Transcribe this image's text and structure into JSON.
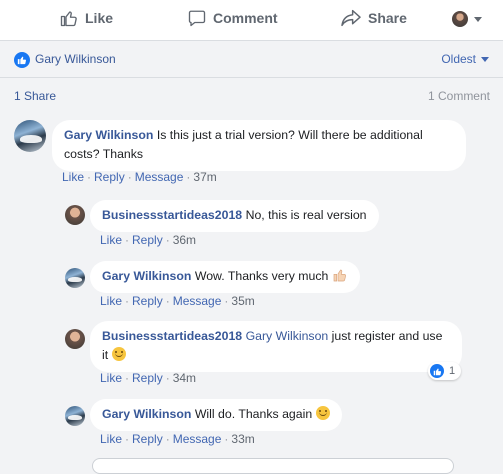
{
  "actions": {
    "like": "Like",
    "comment": "Comment",
    "share": "Share"
  },
  "reactions": {
    "reactor": "Gary Wilkinson",
    "sort": "Oldest"
  },
  "counts": {
    "shares": "1 Share",
    "comments": "1 Comment"
  },
  "comment": {
    "author": "Gary Wilkinson",
    "text": "Is this just a trial version? Will there be additional costs? Thanks",
    "like": "Like",
    "reply": "Reply",
    "message": "Message",
    "time": "37m"
  },
  "replies": [
    {
      "author": "Businessstartideas2018",
      "text": "No, this is real version",
      "like": "Like",
      "reply": "Reply",
      "time": "36m"
    },
    {
      "author": "Gary Wilkinson",
      "text": "Wow. Thanks very much",
      "like": "Like",
      "reply": "Reply",
      "message": "Message",
      "time": "35m"
    },
    {
      "author": "Businessstartideas2018",
      "mention": "Gary Wilkinson",
      "text": "just register and use it",
      "like": "Like",
      "reply": "Reply",
      "time": "34m",
      "reaction_count": "1"
    },
    {
      "author": "Gary Wilkinson",
      "text": "Will do. Thanks again",
      "like": "Like",
      "reply": "Reply",
      "message": "Message",
      "time": "33m"
    }
  ],
  "icons": {
    "like": "thumbs-up-icon",
    "comment": "speech-bubble-icon",
    "share": "share-arrow-icon",
    "smile": "smile-emoji-icon",
    "thumb": "thumbs-up-emoji-icon"
  },
  "colors": {
    "link": "#385898",
    "like_blue": "#1877f2",
    "bg": "#f2f3f5"
  }
}
